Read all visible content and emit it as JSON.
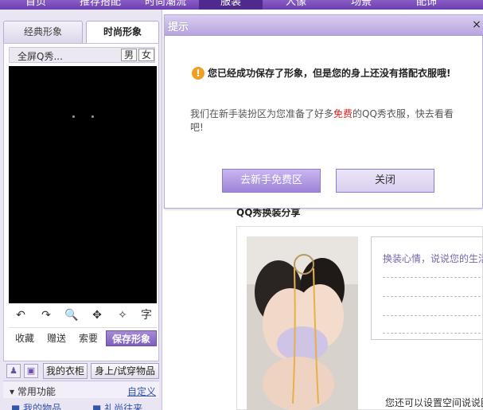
{
  "nav": {
    "items": [
      "首页",
      "推荐搭配",
      "时尚潮流",
      "服装",
      "人像",
      "场景",
      "配饰"
    ],
    "active_index": 3
  },
  "left": {
    "tabs": {
      "classic": "经典形象",
      "fashion": "时尚形象"
    },
    "viewer_title": "全屏Q秀...",
    "gender_male": "男",
    "gender_female": "女",
    "tools": {
      "undo": "↶",
      "redo": "↷",
      "zoom": "🔍",
      "move": "✥",
      "magic": "✧",
      "text": "字"
    },
    "actions": {
      "collect": "收藏",
      "gift": "赠送",
      "request": "索要",
      "save": "保存形象"
    },
    "wardrobe": "我的衣柜",
    "trying": "身上/试穿物品",
    "common": {
      "title": "常用功能",
      "custom": "自定义"
    },
    "quick": [
      "我的物品",
      "礼尚往来"
    ]
  },
  "content": {
    "section_title": "QQ秀换装分享",
    "mood_placeholder": "换装心情，说说您的生活",
    "set_space_text": "您还可以设置空间说说图"
  },
  "dialog": {
    "title": "提示",
    "close": "×",
    "main": "您已经成功保存了形象，但是您的身上还没有搭配衣服哦!",
    "sub_before": "我们在新手装扮区为您准备了好多",
    "sub_free": "免费",
    "sub_after": "的QQ秀衣服，快去看看吧!",
    "btn_go": "去新手免费区",
    "btn_close": "关闭"
  }
}
